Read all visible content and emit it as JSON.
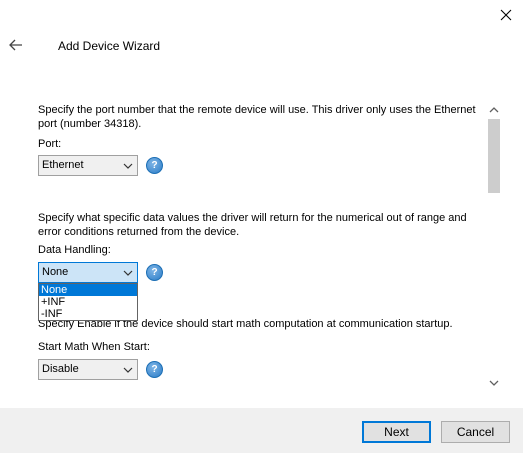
{
  "window": {
    "title": "Add Device Wizard"
  },
  "port_section": {
    "description_line1": "Specify the port number that the remote device will use. This driver only uses the Ethernet",
    "description_line2": "port (number 34318).",
    "label": "Port:",
    "value": "Ethernet"
  },
  "data_handling_section": {
    "description_line1": "Specify what specific data values the driver will return for the numerical out of range and",
    "description_line2": "error conditions returned from the device.",
    "label": "Data Handling:",
    "value": "None",
    "options": [
      "None",
      "+INF",
      "-INF"
    ]
  },
  "math_section": {
    "description": "Specify Enable if the device should start math computation at communication startup.",
    "label": "Start Math When Start:",
    "value": "Disable"
  },
  "footer": {
    "next_label": "Next",
    "cancel_label": "Cancel"
  },
  "help_glyph": "?",
  "icons": {
    "close": "close-icon",
    "back": "back-arrow-icon",
    "help": "help-icon",
    "dropdown": "chevron-down-icon"
  },
  "colors": {
    "accent": "#0078d7",
    "focused_select_bg": "#cce4f7",
    "footer_bg": "#f0f0f0"
  }
}
